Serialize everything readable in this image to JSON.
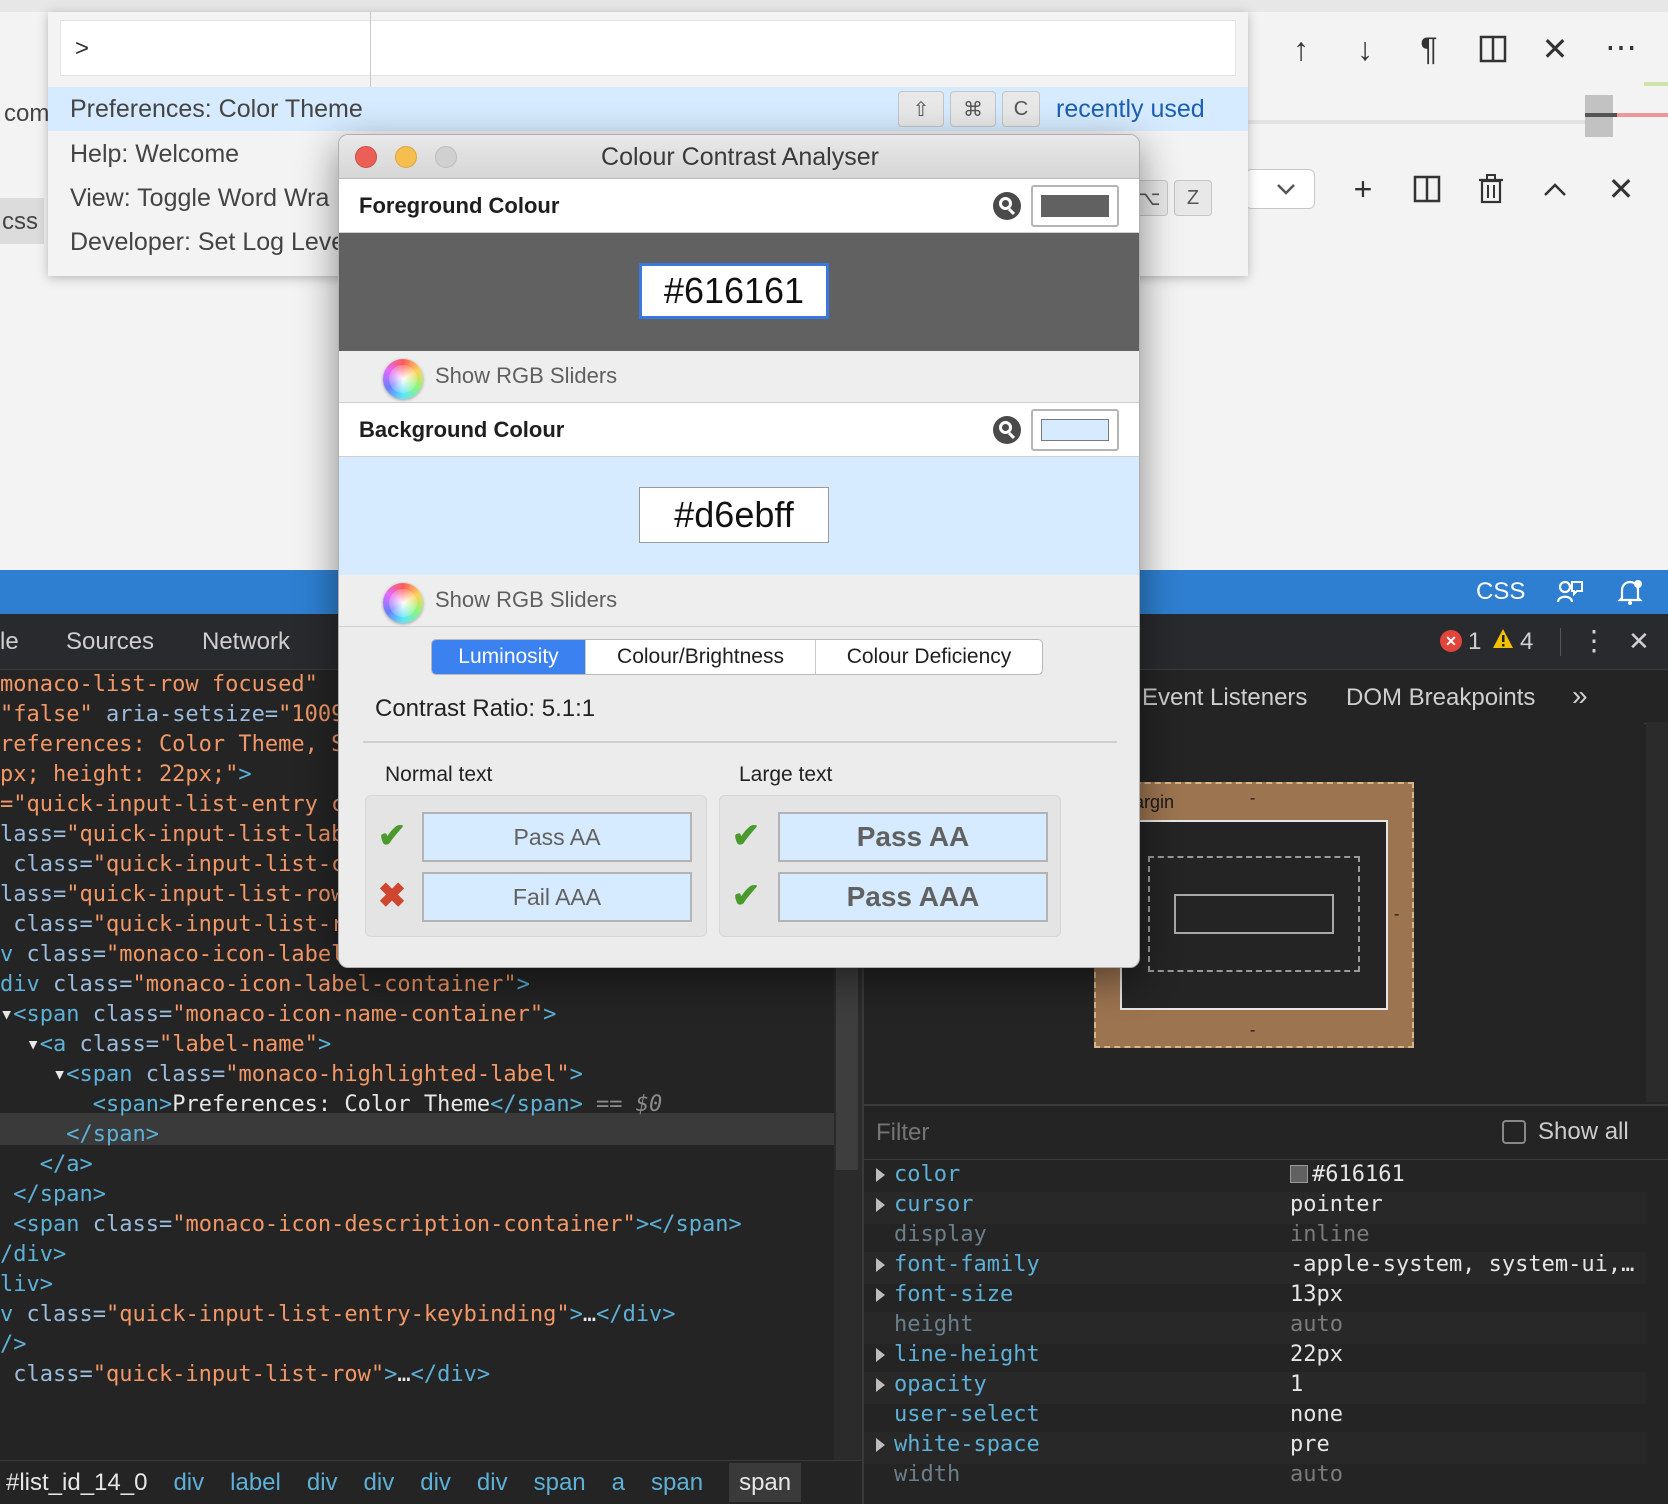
{
  "palette": {
    "input_value": ">",
    "items": [
      {
        "label": "Preferences: Color Theme",
        "keys": [
          "⇧",
          "⌘",
          "C"
        ],
        "tag": "recently used"
      },
      {
        "label": "Help: Welcome"
      },
      {
        "label": "View: Toggle Word Wra"
      },
      {
        "label": "Developer: Set Log Leve"
      }
    ],
    "row3_keys": [
      "⌥",
      "Z"
    ]
  },
  "editor": {
    "gutter_text_1": "com",
    "gutter_text_2": "css"
  },
  "statusbar": {
    "language": "CSS"
  },
  "cca": {
    "title": "Colour Contrast Analyser",
    "foreground": {
      "label": "Foreground Colour",
      "hex": "#616161"
    },
    "background": {
      "label": "Background Colour",
      "hex": "#d6ebff"
    },
    "slider_label": "Show RGB Sliders",
    "tabs": [
      "Luminosity",
      "Colour/Brightness",
      "Colour Deficiency"
    ],
    "active_tab": "Luminosity",
    "contrast_ratio": "Contrast Ratio: 5.1:1",
    "normal_text": {
      "label": "Normal text",
      "results": [
        {
          "status": "pass",
          "text": "Pass AA"
        },
        {
          "status": "fail",
          "text": "Fail AAA"
        }
      ]
    },
    "large_text": {
      "label": "Large text",
      "results": [
        {
          "status": "pass",
          "text": "Pass AA"
        },
        {
          "status": "pass",
          "text": "Pass AAA"
        }
      ]
    }
  },
  "devtools": {
    "tabs": [
      "le",
      "Sources",
      "Network"
    ],
    "error_count": "1",
    "warning_count": "4",
    "right_tabs": [
      "Event Listeners",
      "DOM Breakpoints"
    ],
    "boxmodel": {
      "margin_label": "argin",
      "margin_top": "-",
      "margin_right": "-",
      "margin_bottom": "-"
    },
    "filter_placeholder": "Filter",
    "show_all_label": "Show all",
    "selected_marker": "== $0",
    "code_lines": [
      {
        "parts": [
          [
            "v",
            "monaco-list-row focused\""
          ]
        ]
      },
      {
        "parts": [
          [
            "v",
            "\"false\""
          ],
          [
            "a",
            " aria-setsize="
          ],
          [
            "v",
            "\"1009"
          ]
        ]
      },
      {
        "parts": [
          [
            "v",
            "references: Color Theme, S"
          ]
        ]
      },
      {
        "parts": [
          [
            "v",
            "px; height: 22px;\""
          ],
          [
            "t",
            ">"
          ]
        ]
      },
      {
        "parts": [
          [
            "v",
            "=\"quick-input-list-entry c"
          ]
        ]
      },
      {
        "parts": [
          [
            "a",
            "lass="
          ],
          [
            "v",
            "\"quick-input-list-lab"
          ]
        ]
      },
      {
        "parts": [
          [
            "a",
            " class="
          ],
          [
            "v",
            "\"quick-input-list-c"
          ]
        ]
      },
      {
        "parts": [
          [
            "a",
            "lass="
          ],
          [
            "v",
            "\"quick-input-list-row"
          ]
        ]
      },
      {
        "parts": [
          [
            "a",
            " class="
          ],
          [
            "v",
            "\"quick-input-list-r"
          ]
        ]
      },
      {
        "parts": [
          [
            "t",
            "v "
          ],
          [
            "a",
            "class="
          ],
          [
            "v",
            "\"monaco-icon-label\""
          ],
          [
            "t",
            " >"
          ]
        ]
      },
      {
        "parts": [
          [
            "t",
            "div "
          ],
          [
            "a",
            "class="
          ],
          [
            "v",
            "\"monaco-icon-label-container\""
          ],
          [
            "t",
            ">"
          ]
        ]
      },
      {
        "parts": [
          [
            "x",
            "▾"
          ],
          [
            "t",
            "<span "
          ],
          [
            "a",
            "class="
          ],
          [
            "v",
            "\"monaco-icon-name-container\""
          ],
          [
            "t",
            ">"
          ]
        ]
      },
      {
        "parts": [
          [
            "x",
            "  ▾"
          ],
          [
            "t",
            "<a "
          ],
          [
            "a",
            "class="
          ],
          [
            "v",
            "\"label-name\""
          ],
          [
            "t",
            ">"
          ]
        ]
      },
      {
        "parts": [
          [
            "x",
            "    ▾"
          ],
          [
            "t",
            "<span "
          ],
          [
            "a",
            "class="
          ],
          [
            "v",
            "\"monaco-highlighted-label\""
          ],
          [
            "t",
            ">"
          ]
        ]
      },
      {
        "parts": [
          [
            "x",
            "       "
          ],
          [
            "t",
            "<span>"
          ],
          [
            "w",
            "Preferences: Color Theme"
          ],
          [
            "t",
            "</span>"
          ],
          [
            "d",
            " == $0"
          ]
        ]
      },
      {
        "parts": [
          [
            "x",
            "     "
          ],
          [
            "t",
            "</span>"
          ]
        ]
      },
      {
        "parts": [
          [
            "x",
            "   "
          ],
          [
            "t",
            "</a>"
          ]
        ]
      },
      {
        "parts": [
          [
            "x",
            " "
          ],
          [
            "t",
            "</span>"
          ]
        ]
      },
      {
        "parts": [
          [
            "x",
            " "
          ],
          [
            "t",
            "<span "
          ],
          [
            "a",
            "class="
          ],
          [
            "v",
            "\"monaco-icon-description-container\""
          ],
          [
            "t",
            "></span>"
          ]
        ]
      },
      {
        "parts": [
          [
            "t",
            "/div>"
          ]
        ]
      },
      {
        "parts": [
          [
            "t",
            "liv>"
          ]
        ]
      },
      {
        "parts": [
          [
            "t",
            "v "
          ],
          [
            "a",
            "class="
          ],
          [
            "v",
            "\"quick-input-list-entry-keybinding\""
          ],
          [
            "t",
            ">"
          ],
          [
            "w",
            "…"
          ],
          [
            "t",
            "</div>"
          ]
        ]
      },
      {
        "parts": [
          [
            "t",
            "/>"
          ]
        ]
      },
      {
        "parts": [
          [
            "a",
            " class="
          ],
          [
            "v",
            "\"quick-input-list-row\""
          ],
          [
            "t",
            ">"
          ],
          [
            "w",
            "…"
          ],
          [
            "t",
            "</div>"
          ]
        ]
      }
    ],
    "breadcrumbs": [
      "#list_id_14_0",
      "div",
      "label",
      "div",
      "div",
      "div",
      "div",
      "span",
      "a",
      "span",
      "span"
    ],
    "properties": [
      {
        "name": "color",
        "value": "#616161",
        "expandable": true,
        "inherited": false,
        "swatch": "#616161"
      },
      {
        "name": "cursor",
        "value": "pointer",
        "expandable": true,
        "inherited": false
      },
      {
        "name": "display",
        "value": "inline",
        "expandable": false,
        "inherited": true
      },
      {
        "name": "font-family",
        "value": "-apple-system, system-ui,…",
        "expandable": true,
        "inherited": false
      },
      {
        "name": "font-size",
        "value": "13px",
        "expandable": true,
        "inherited": false
      },
      {
        "name": "height",
        "value": "auto",
        "expandable": false,
        "inherited": true
      },
      {
        "name": "line-height",
        "value": "22px",
        "expandable": true,
        "inherited": false
      },
      {
        "name": "opacity",
        "value": "1",
        "expandable": true,
        "inherited": false
      },
      {
        "name": "user-select",
        "value": "none",
        "expandable": false,
        "inherited": false
      },
      {
        "name": "white-space",
        "value": "pre",
        "expandable": true,
        "inherited": false
      },
      {
        "name": "width",
        "value": "auto",
        "expandable": false,
        "inherited": true
      }
    ]
  },
  "colors": {
    "accent_blue": "#2e7fd1",
    "highlight_row": "#d6ebff",
    "foreground_sample": "#616161",
    "background_sample": "#d6ebff"
  }
}
